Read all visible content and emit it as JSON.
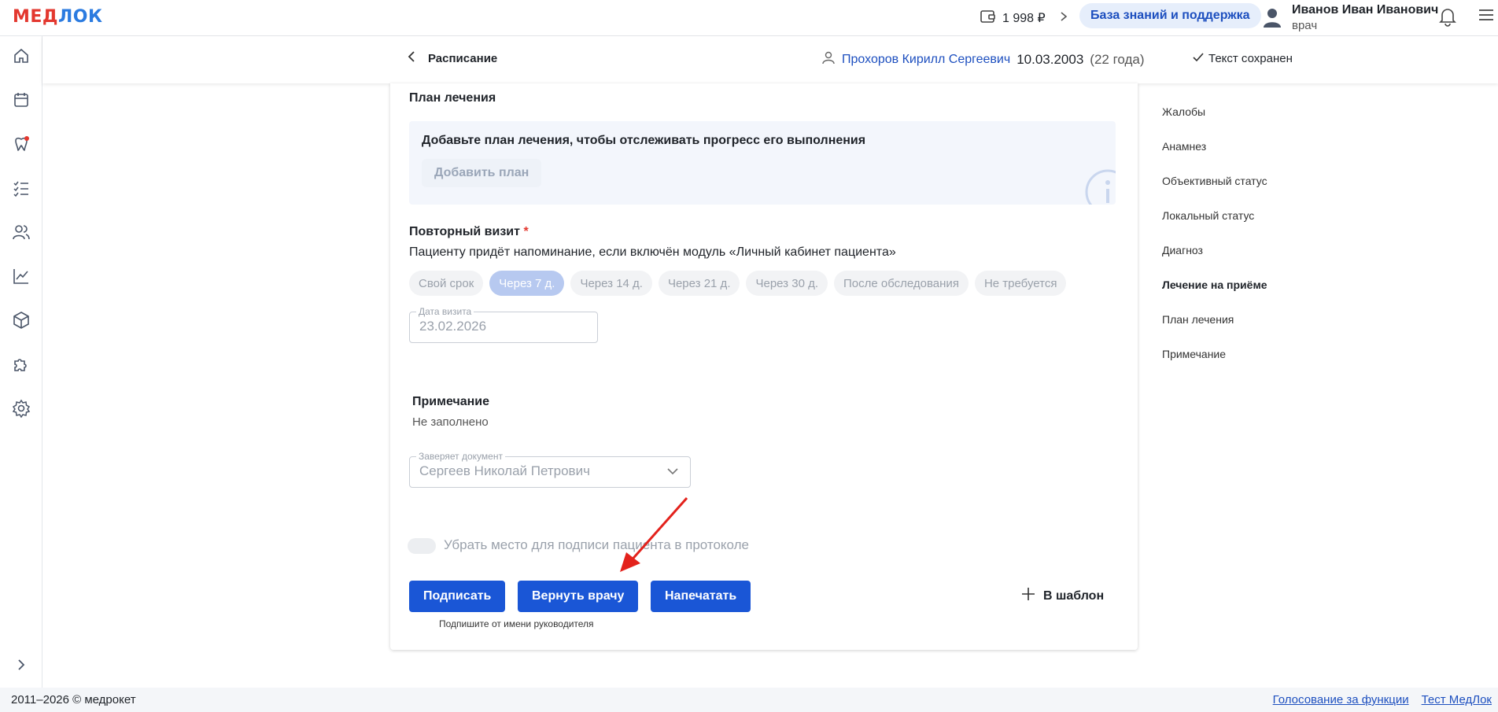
{
  "header": {
    "logo_part1": "МЕД",
    "logo_part2": "ЛОК",
    "balance": "1 998 ₽",
    "knowledge_base": "База знаний и поддержка",
    "user_name": "Иванов Иван Иванович",
    "user_role": "врач"
  },
  "subheader": {
    "back_label": "Расписание",
    "patient_name": "Прохоров Кирилл Сергеевич",
    "patient_birthdate": "10.03.2003",
    "patient_age": "(22 года)",
    "save_status": "Текст сохранен"
  },
  "plan": {
    "title": "План лечения",
    "message": "Добавьте план лечения, чтобы отслеживать прогресс его выполнения",
    "add_button": "Добавить план"
  },
  "revisit": {
    "title": "Повторный визит",
    "required_mark": "*",
    "hint": "Пациенту придёт напоминание, если включён модуль «Личный кабинет пациента»",
    "chips": [
      {
        "label": "Свой срок",
        "active": false
      },
      {
        "label": "Через 7 д.",
        "active": true
      },
      {
        "label": "Через 14 д.",
        "active": false
      },
      {
        "label": "Через 21 д.",
        "active": false
      },
      {
        "label": "Через 30 д.",
        "active": false
      },
      {
        "label": "После обследования",
        "active": false
      },
      {
        "label": "Не требуется",
        "active": false
      }
    ],
    "date_label": "Дата визита",
    "date_value": "23.02.2026"
  },
  "note": {
    "title": "Примечание",
    "value": "Не заполнено"
  },
  "certifier": {
    "label": "Заверяет документ",
    "value": "Сергеев Николай Петрович"
  },
  "signature_toggle": {
    "label": "Убрать место для подписи пациента в протоколе",
    "on": false
  },
  "actions": {
    "sign": "Подписать",
    "return": "Вернуть врачу",
    "print": "Напечатать",
    "template": "В шаблон",
    "sign_hint": "Подпишите от имени руководителя"
  },
  "anchors": [
    {
      "label": "Жалобы",
      "active": false
    },
    {
      "label": "Анамнез",
      "active": false
    },
    {
      "label": "Объективный статус",
      "active": false
    },
    {
      "label": "Локальный статус",
      "active": false
    },
    {
      "label": "Диагноз",
      "active": false
    },
    {
      "label": "Лечение на приёме",
      "active": true
    },
    {
      "label": "План лечения",
      "active": false
    },
    {
      "label": "Примечание",
      "active": false
    }
  ],
  "footer": {
    "copyright": "2011–2026 © медрокет",
    "vote_link": "Голосование за функции",
    "test_link": "Тест МедЛок"
  },
  "colors": {
    "primary": "#1a56d6",
    "link": "#1d4fbf",
    "accent_red": "#e3382f",
    "annotation_arrow": "#e3221c"
  },
  "icons": {
    "left_nav": [
      "home-icon",
      "calendar-icon",
      "tooth-icon",
      "checklist-icon",
      "users-icon",
      "chart-icon",
      "box-icon",
      "puzzle-icon",
      "gear-icon",
      "chevron-right-icon"
    ]
  }
}
